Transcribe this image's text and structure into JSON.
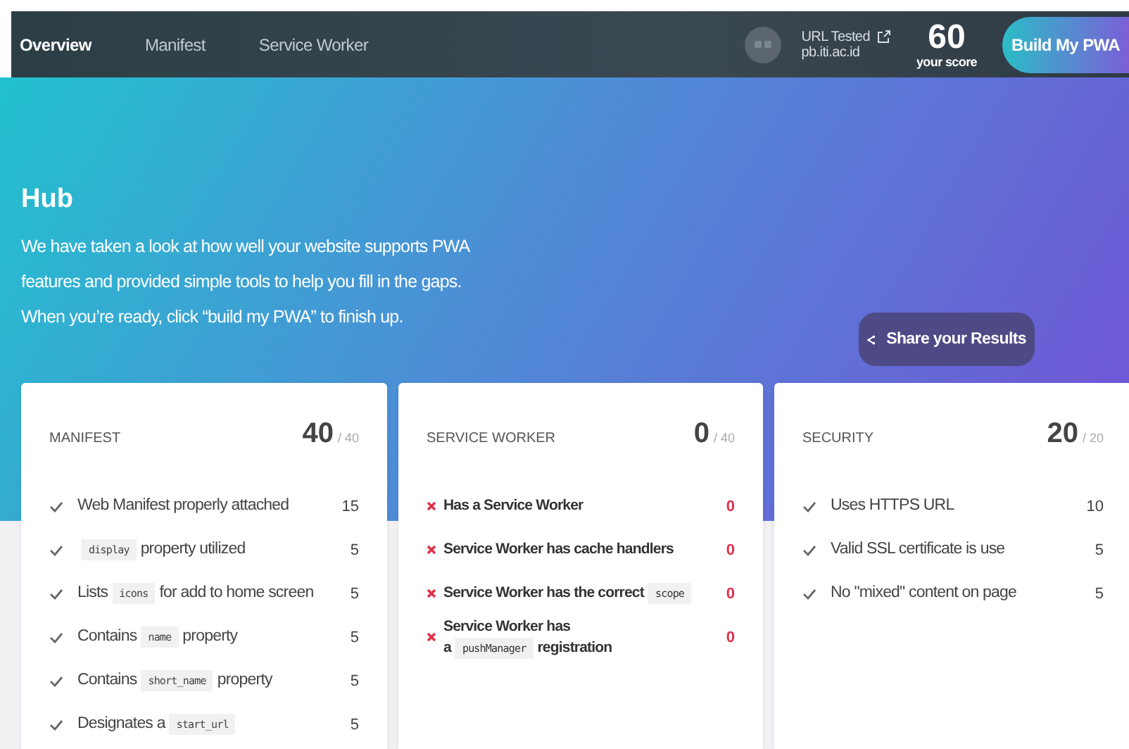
{
  "nav": {
    "tabs": [
      {
        "label": "Overview",
        "selected": true
      },
      {
        "label": "Manifest",
        "selected": false
      },
      {
        "label": "Service Worker",
        "selected": false
      }
    ],
    "url_label": "URL Tested",
    "url": "pb.iti.ac.id",
    "score": "60",
    "score_label": "your score",
    "build_button": "Build My PWA"
  },
  "hero": {
    "title": "Hub",
    "text": "We have taken a look at how well your website supports PWA features and provided simple tools to help you fill in the gaps. When you’re ready, click “build my PWA” to finish up.",
    "share_button": "Share your Results"
  },
  "cards": [
    {
      "title": "MANIFEST",
      "score": "40",
      "total": "/ 40",
      "items": [
        {
          "passed": true,
          "parts": [
            {
              "kind": "text",
              "text": "Web Manifest properly attached"
            }
          ],
          "points": "15"
        },
        {
          "passed": true,
          "parts": [
            {
              "kind": "code",
              "text": "display"
            },
            {
              "kind": "text",
              "text": "property utilized"
            }
          ],
          "points": "5"
        },
        {
          "passed": true,
          "parts": [
            {
              "kind": "text",
              "text": "Lists"
            },
            {
              "kind": "code",
              "text": "icons"
            },
            {
              "kind": "text",
              "text": "for add to home screen"
            }
          ],
          "points": "5"
        },
        {
          "passed": true,
          "parts": [
            {
              "kind": "text",
              "text": "Contains"
            },
            {
              "kind": "code",
              "text": "name"
            },
            {
              "kind": "text",
              "text": "property"
            }
          ],
          "points": "5"
        },
        {
          "passed": true,
          "parts": [
            {
              "kind": "text",
              "text": "Contains"
            },
            {
              "kind": "code",
              "text": "short_name"
            },
            {
              "kind": "text",
              "text": "property"
            }
          ],
          "points": "5"
        },
        {
          "passed": true,
          "parts": [
            {
              "kind": "text",
              "text": "Designates a"
            },
            {
              "kind": "code",
              "text": "start_url"
            }
          ],
          "points": "5"
        }
      ]
    },
    {
      "title": "SERVICE WORKER",
      "score": "0",
      "total": "/ 40",
      "items": [
        {
          "passed": false,
          "parts": [
            {
              "kind": "text",
              "text": "Has a Service Worker"
            }
          ],
          "points": "0"
        },
        {
          "passed": false,
          "parts": [
            {
              "kind": "text",
              "text": "Service Worker has cache handlers"
            }
          ],
          "points": "0"
        },
        {
          "passed": false,
          "parts": [
            {
              "kind": "text",
              "text": "Service Worker has the correct"
            },
            {
              "kind": "code",
              "text": "scope"
            }
          ],
          "points": "0"
        },
        {
          "passed": false,
          "parts": [
            {
              "kind": "text",
              "text": "Service Worker has a"
            },
            {
              "kind": "code",
              "text": "pushManager"
            },
            {
              "kind": "text",
              "text": "registration"
            }
          ],
          "points": "0"
        }
      ]
    },
    {
      "title": "SECURITY",
      "score": "20",
      "total": "/ 20",
      "items": [
        {
          "passed": true,
          "parts": [
            {
              "kind": "text",
              "text": "Uses HTTPS URL"
            }
          ],
          "points": "10"
        },
        {
          "passed": true,
          "parts": [
            {
              "kind": "text",
              "text": "Valid SSL certificate is use"
            }
          ],
          "points": "5"
        },
        {
          "passed": true,
          "parts": [
            {
              "kind": "text",
              "text": "No \"mixed\" content on page"
            }
          ],
          "points": "5"
        }
      ]
    }
  ]
}
